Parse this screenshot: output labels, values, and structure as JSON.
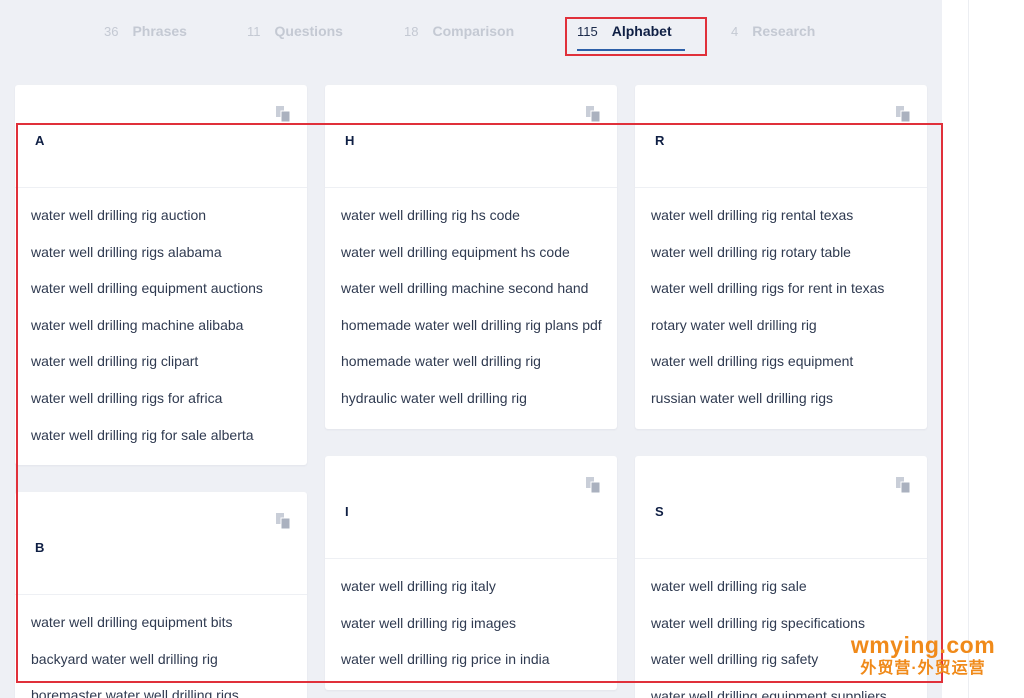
{
  "tabs": [
    {
      "count": "36",
      "label": "Phrases",
      "active": false
    },
    {
      "count": "11",
      "label": "Questions",
      "active": false
    },
    {
      "count": "18",
      "label": "Comparison",
      "active": false
    },
    {
      "count": "115",
      "label": "Alphabet",
      "active": true
    },
    {
      "count": "4",
      "label": "Research",
      "active": false
    }
  ],
  "cards": {
    "a": {
      "letter": "A",
      "icon": "copy-icon",
      "items": [
        "water well drilling rig auction",
        "water well drilling rigs alabama",
        "water well drilling equipment auctions",
        "water well drilling machine alibaba",
        "water well drilling rig clipart",
        "water well drilling rigs for africa",
        "water well drilling rig for sale alberta"
      ]
    },
    "b": {
      "letter": "B",
      "icon": "copy-icon",
      "items": [
        "water well drilling equipment bits",
        "backyard water well drilling rig",
        "boremaster water well drilling rigs"
      ]
    },
    "h": {
      "letter": "H",
      "icon": "copy-icon",
      "items": [
        "water well drilling rig hs code",
        "water well drilling equipment hs code",
        "water well drilling machine second hand",
        "homemade water well drilling rig plans pdf",
        "homemade water well drilling rig",
        "hydraulic water well drilling rig"
      ]
    },
    "i": {
      "letter": "I",
      "icon": "copy-icon",
      "items": [
        "water well drilling rig italy",
        "water well drilling rig images",
        "water well drilling rig price in india"
      ]
    },
    "r": {
      "letter": "R",
      "icon": "copy-icon",
      "items": [
        "water well drilling rig rental texas",
        "water well drilling rig rotary table",
        "water well drilling rigs for rent in texas",
        "rotary water well drilling rig",
        "water well drilling rigs equipment",
        "russian water well drilling rigs"
      ]
    },
    "s": {
      "letter": "S",
      "icon": "copy-icon",
      "items": [
        "water well drilling rig sale",
        "water well drilling rig specifications",
        "water well drilling rig safety",
        "water well drilling equipment suppliers"
      ]
    }
  },
  "watermark": {
    "main": "wmying.com",
    "sub": "外贸营·外贸运营"
  },
  "colors": {
    "highlight": "#e0303a",
    "accent": "#2d5fa8",
    "text_dark": "#0f1f44",
    "watermark": "#f08a1a"
  }
}
